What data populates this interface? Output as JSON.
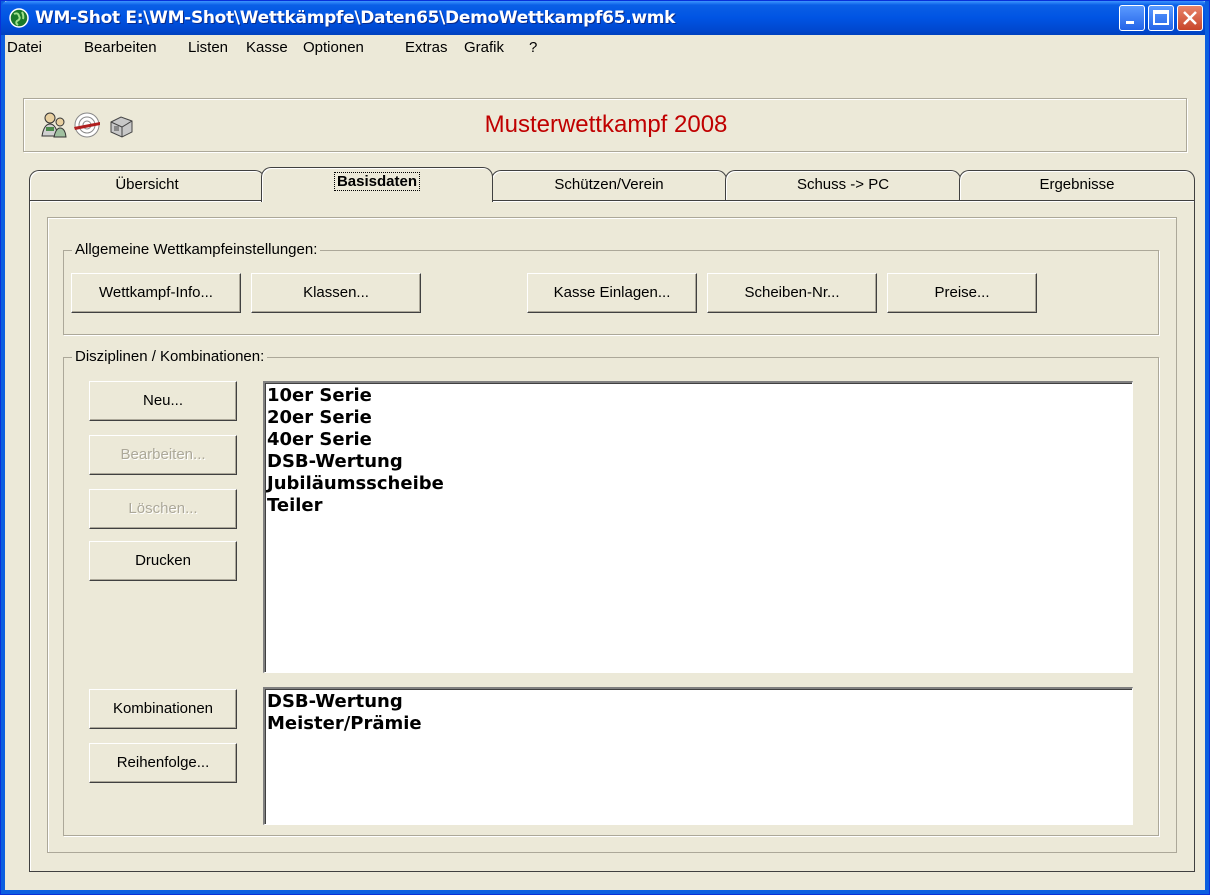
{
  "window": {
    "title": "WM-Shot E:\\WM-Shot\\Wettkämpfe\\Daten65\\DemoWettkampf65.wmk"
  },
  "menu": [
    "Datei",
    "Bearbeiten",
    "Listen",
    "Kasse",
    "Optionen",
    "Extras",
    "Grafik",
    "?"
  ],
  "header": {
    "competition_title": "Musterwettkampf 2008"
  },
  "tabs": [
    "Übersicht",
    "Basisdaten",
    "Schützen/Verein",
    "Schuss -> PC",
    "Ergebnisse"
  ],
  "active_tab": "Basisdaten",
  "general_settings": {
    "legend": "Allgemeine Wettkampfeinstellungen:",
    "buttons": [
      "Wettkampf-Info...",
      "Klassen...",
      "Kasse Einlagen...",
      "Scheiben-Nr...",
      "Preise..."
    ]
  },
  "disciplines": {
    "legend": "Disziplinen / Kombinationen:",
    "buttons": {
      "new": "Neu...",
      "edit": "Bearbeiten...",
      "delete": "Löschen...",
      "print": "Drucken",
      "combinations": "Kombinationen",
      "order": "Reihenfolge..."
    },
    "discipline_list": [
      "10er Serie",
      "20er Serie",
      "40er Serie",
      "DSB-Wertung",
      "Jubiläumsscheibe",
      "Teiler"
    ],
    "combination_list": [
      "DSB-Wertung",
      "Meister/Prämie"
    ]
  }
}
